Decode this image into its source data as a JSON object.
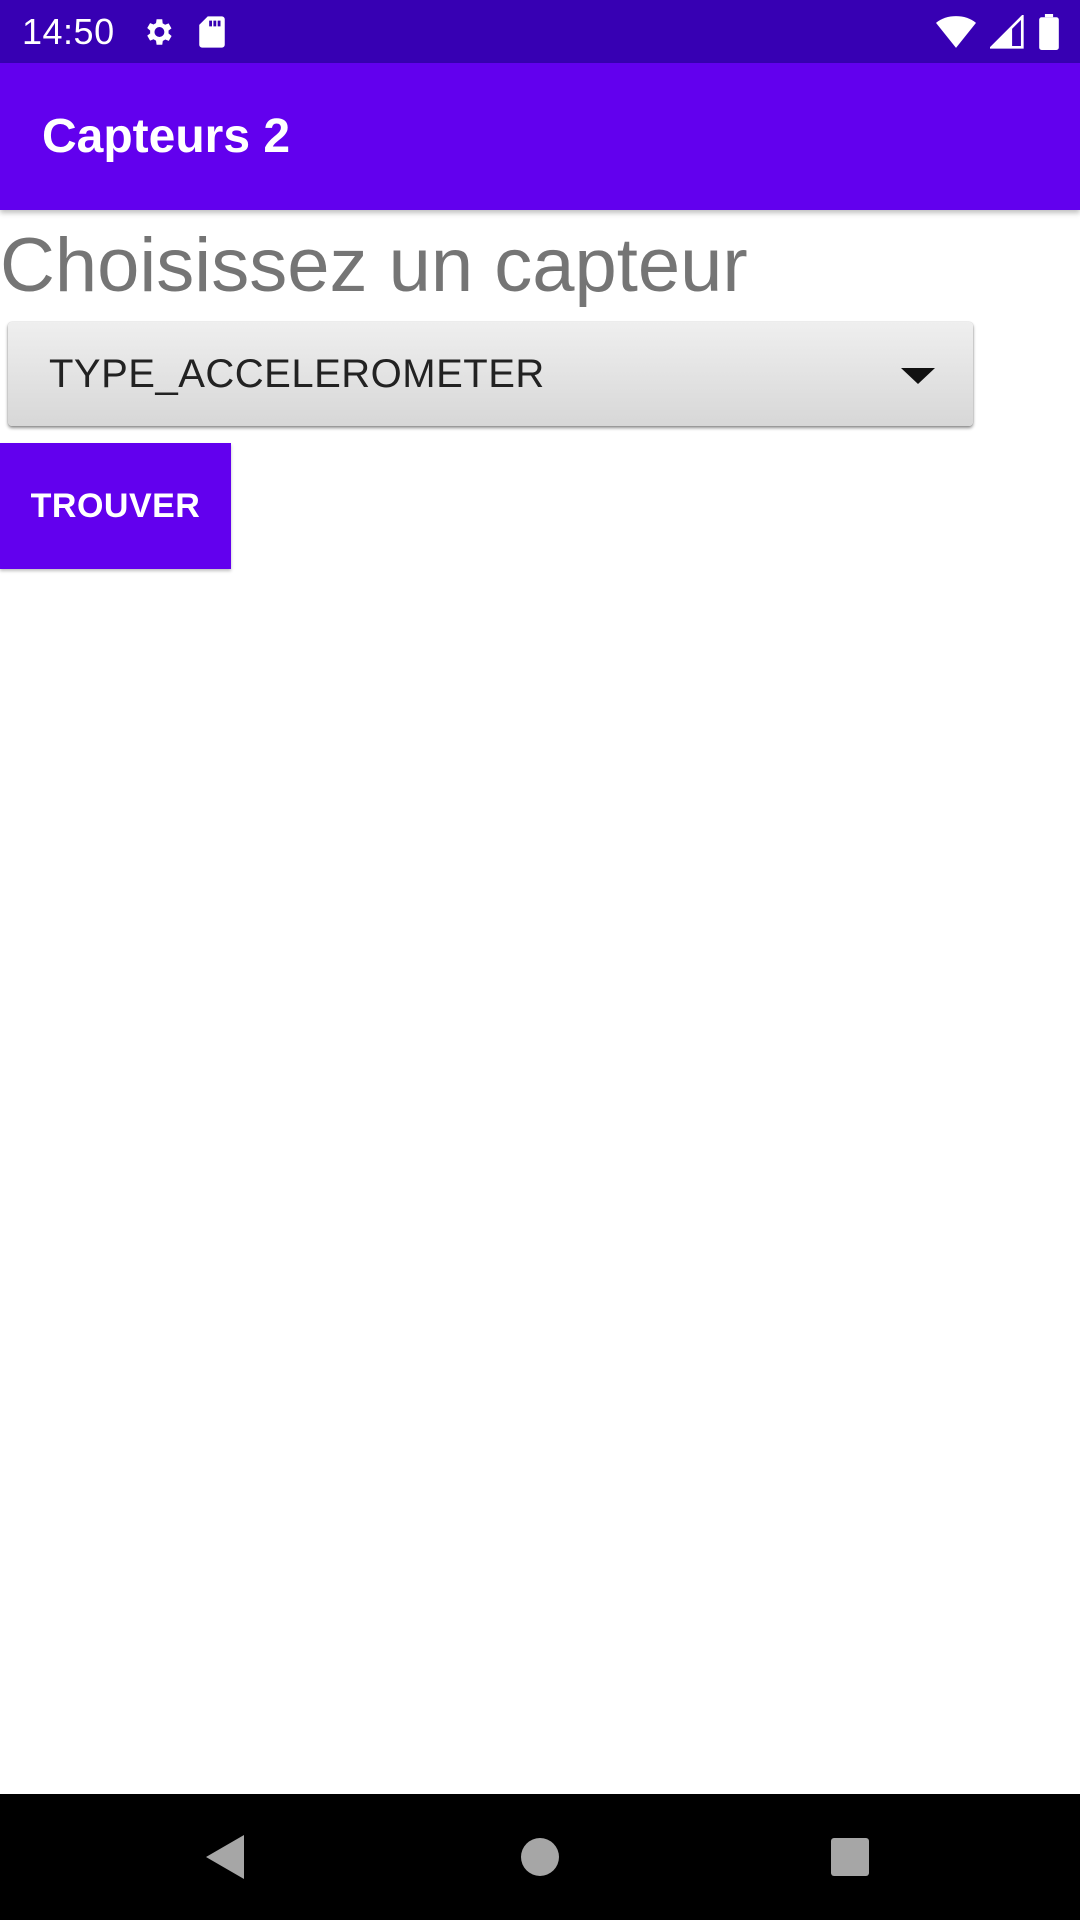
{
  "status_bar": {
    "time": "14:50",
    "left_icons": [
      "settings-icon",
      "sd-card-icon"
    ],
    "right_icons": [
      "wifi-icon",
      "cell-signal-icon",
      "battery-icon"
    ],
    "background": "#3700b3"
  },
  "app_bar": {
    "title": "Capteurs 2",
    "background": "#6200ee"
  },
  "main": {
    "heading": "Choisissez un capteur",
    "spinner": {
      "selected_value": "TYPE_ACCELEROMETER",
      "icon": "dropdown-arrow-icon"
    },
    "find_button_label": "TROUVER",
    "accent": "#6200ee"
  },
  "nav_bar": {
    "buttons": [
      "back-icon",
      "home-icon",
      "recents-icon"
    ]
  }
}
